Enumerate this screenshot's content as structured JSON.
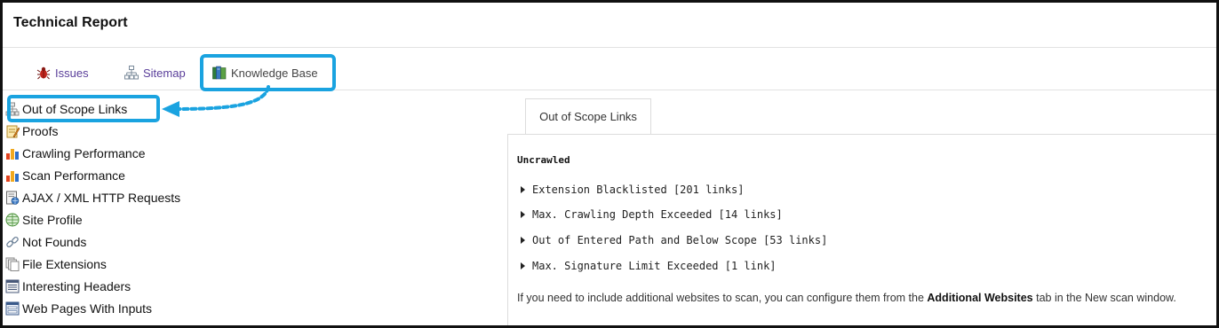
{
  "header": {
    "title": "Technical Report"
  },
  "tabs": [
    {
      "label": "Issues",
      "icon": "bug-icon"
    },
    {
      "label": "Sitemap",
      "icon": "sitemap-icon"
    },
    {
      "label": "Knowledge Base",
      "icon": "books-icon"
    }
  ],
  "tree": {
    "items": [
      {
        "label": "Out of Scope Links",
        "icon": "sitemap-node-icon"
      },
      {
        "label": "Proofs",
        "icon": "pencil-document-icon"
      },
      {
        "label": "Crawling Performance",
        "icon": "bar-chart-icon"
      },
      {
        "label": "Scan Performance",
        "icon": "bar-chart-icon"
      },
      {
        "label": "AJAX / XML HTTP Requests",
        "icon": "document-globe-icon"
      },
      {
        "label": "Site Profile",
        "icon": "globe-table-icon"
      },
      {
        "label": "Not Founds",
        "icon": "broken-link-icon"
      },
      {
        "label": "File Extensions",
        "icon": "files-icon"
      },
      {
        "label": "Interesting Headers",
        "icon": "list-document-icon"
      },
      {
        "label": "Web Pages With Inputs",
        "icon": "form-icon"
      }
    ]
  },
  "panel": {
    "tab_label": "Out of Scope Links",
    "heading": "Uncrawled",
    "groups": [
      "Extension Blacklisted [201 links]",
      "Max. Crawling Depth Exceeded [14 links]",
      "Out of Entered Path and Below Scope [53 links]",
      "Max. Signature Limit Exceeded [1 link]"
    ],
    "note_before": "If you need to include additional websites to scan, you can configure them from the ",
    "note_bold": "Additional Websites",
    "note_after": " tab in the New scan window."
  },
  "colors": {
    "highlight": "#1aa3e0",
    "tab_link": "#5a3e9a"
  }
}
